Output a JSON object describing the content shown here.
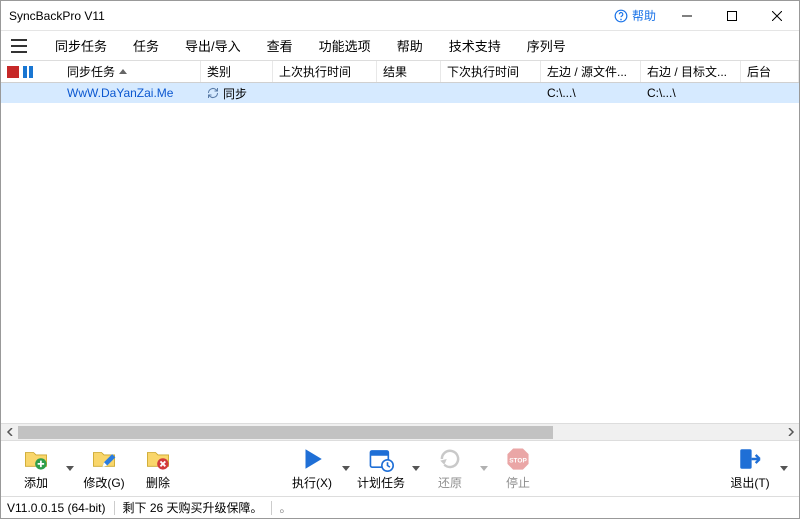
{
  "title": "SyncBackPro V11",
  "titlebar": {
    "help_label": "帮助"
  },
  "menu": {
    "items": [
      "同步任务",
      "任务",
      "导出/导入",
      "查看",
      "功能选项",
      "帮助",
      "技术支持",
      "序列号"
    ]
  },
  "columns": {
    "profile": "同步任务",
    "type": "类别",
    "last_run": "上次执行时间",
    "result": "结果",
    "next_run": "下次执行时间",
    "left": "左边 / 源文件...",
    "right": "右边 / 目标文...",
    "background": "后台"
  },
  "row": {
    "name": "WwW.DaYanZai.Me",
    "type": "同步",
    "last_run": "",
    "result": "",
    "next_run": "",
    "left": "C:\\...\\",
    "right": "C:\\...\\"
  },
  "toolbar": {
    "add": "添加",
    "modify": "修改(G)",
    "delete": "删除",
    "run": "执行(X)",
    "schedule": "计划任务",
    "restore": "还原",
    "stop": "停止",
    "exit": "退出(T)"
  },
  "status": {
    "version": "V11.0.0.15 (64-bit)",
    "trial": "剩下 26 天购买升级保障。"
  }
}
